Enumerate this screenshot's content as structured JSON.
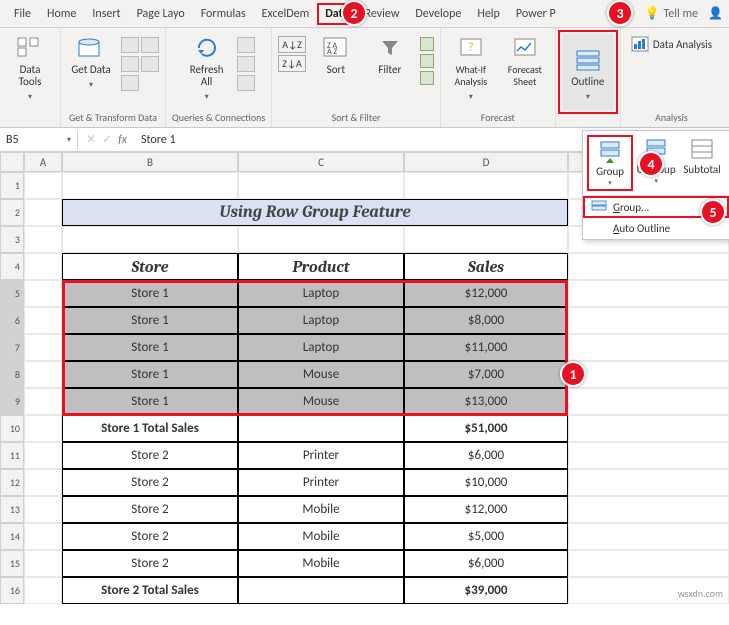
{
  "tabs": [
    "File",
    "Home",
    "Insert",
    "Page Layo",
    "Formulas",
    "ExcelDem",
    "Data",
    "Review",
    "Develope",
    "Help",
    "Power P"
  ],
  "active_tab_index": 6,
  "tellme": "Tell me",
  "ribbon": {
    "data_tools": "Data Tools",
    "get_data": "Get Data",
    "transform_label": "Get & Transform Data",
    "refresh_all": "Refresh All",
    "queries_label": "Queries & Connections",
    "az": "A→Z",
    "za": "Z→A",
    "sort": "Sort",
    "filter": "Filter",
    "sortfilter_label": "Sort & Filter",
    "whatif": "What-If Analysis",
    "forecast": "Forecast Sheet",
    "forecast_label": "Forecast",
    "outline": "Outline",
    "data_analysis": "Data Analysis",
    "analysis_label": "Analysis",
    "group": "Group",
    "ungroup": "Ungroup",
    "subtotal": "Subtotal",
    "group_menu": "Group...",
    "auto_outline": "Auto Outline"
  },
  "namebox": "B5",
  "formula_value": "Store 1",
  "fx": "fx",
  "columns": [
    "A",
    "B",
    "C",
    "D"
  ],
  "title": "Using Row Group Feature",
  "headers": {
    "store": "Store",
    "product": "Product",
    "sales": "Sales"
  },
  "rows": [
    {
      "n": 1,
      "type": "blank"
    },
    {
      "n": 2,
      "type": "title"
    },
    {
      "n": 3,
      "type": "blank"
    },
    {
      "n": 4,
      "type": "header"
    },
    {
      "n": 5,
      "type": "d",
      "sel": true,
      "b": "Store 1",
      "c": "Laptop",
      "d": "$12,000"
    },
    {
      "n": 6,
      "type": "d",
      "sel": true,
      "b": "Store 1",
      "c": "Laptop",
      "d": "$8,000"
    },
    {
      "n": 7,
      "type": "d",
      "sel": true,
      "b": "Store 1",
      "c": "Laptop",
      "d": "$11,000"
    },
    {
      "n": 8,
      "type": "d",
      "sel": true,
      "b": "Store 1",
      "c": "Mouse",
      "d": "$7,000"
    },
    {
      "n": 9,
      "type": "d",
      "sel": true,
      "b": "Store 1",
      "c": "Mouse",
      "d": "$13,000"
    },
    {
      "n": 10,
      "type": "total",
      "b": "Store 1 Total Sales",
      "c": "",
      "d": "$51,000"
    },
    {
      "n": 11,
      "type": "d",
      "b": "Store 2",
      "c": "Printer",
      "d": "$6,000"
    },
    {
      "n": 12,
      "type": "d",
      "b": "Store 2",
      "c": "Printer",
      "d": "$10,000"
    },
    {
      "n": 13,
      "type": "d",
      "b": "Store 2",
      "c": "Mobile",
      "d": "$12,000"
    },
    {
      "n": 14,
      "type": "d",
      "b": "Store 2",
      "c": "Mobile",
      "d": "$5,000"
    },
    {
      "n": 15,
      "type": "d",
      "b": "Store 2",
      "c": "Mobile",
      "d": "$6,000"
    },
    {
      "n": 16,
      "type": "total",
      "b": "Store 2 Total Sales",
      "c": "",
      "d": "$39,000"
    }
  ],
  "callouts": {
    "1": "1",
    "2": "2",
    "3": "3",
    "4": "4",
    "5": "5"
  },
  "watermark": "wsxdn.com"
}
